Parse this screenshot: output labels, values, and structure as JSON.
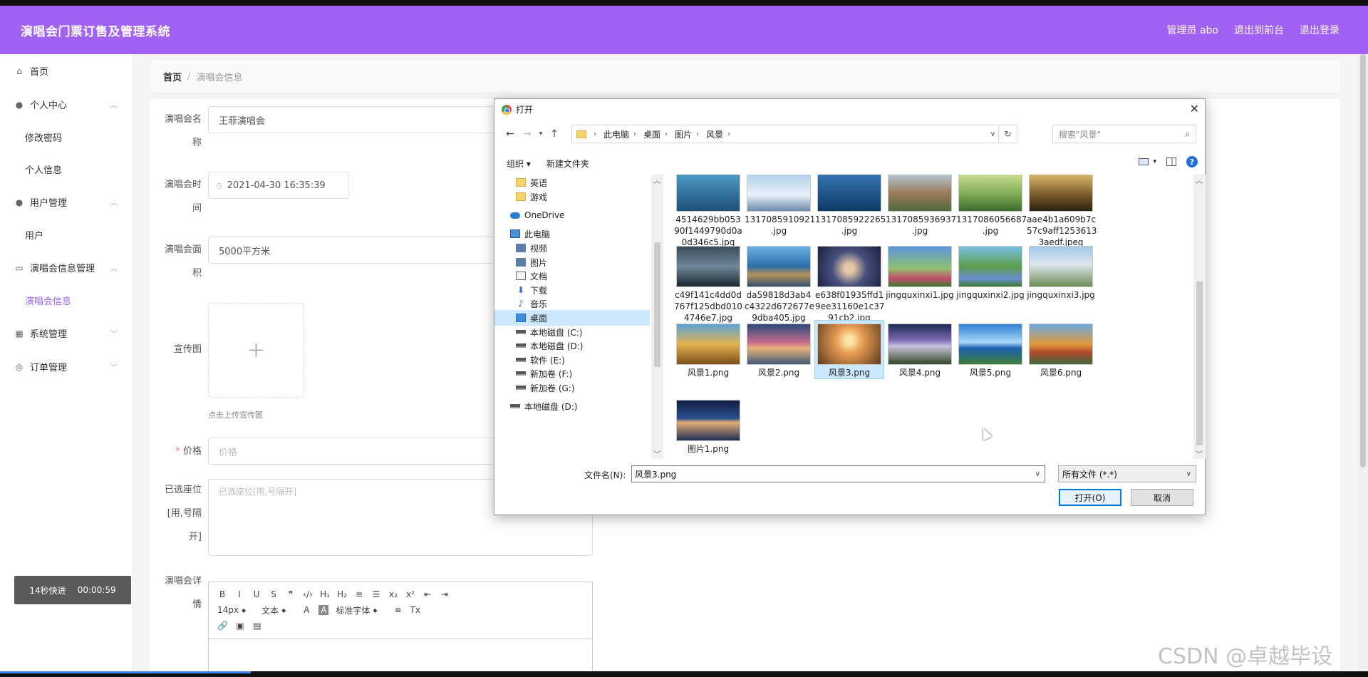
{
  "header": {
    "title": "演唱会门票订售及管理系统",
    "admin": "管理员 abo",
    "to_front": "退出到前台",
    "logout": "退出登录"
  },
  "sidebar": {
    "home": "首页",
    "personal": "个人中心",
    "change_password": "修改密码",
    "personal_info": "个人信息",
    "user_mgmt": "用户管理",
    "users": "用户",
    "concert_mgmt": "演唱会信息管理",
    "concert_info": "演唱会信息",
    "system_mgmt": "系统管理",
    "order_mgmt": "订单管理",
    "timer_label": "14秒快进",
    "timer_value": "00:00:59"
  },
  "breadcrumb": {
    "home": "首页",
    "sep": "/",
    "current": "演唱会信息"
  },
  "form": {
    "name_label_1": "演唱会名",
    "name_label_2": "称",
    "name_value": "王菲演唱会",
    "time_label_1": "演唱会时",
    "time_label_2": "间",
    "time_value": "2021-04-30 16:35:39",
    "area_label_1": "演唱会面",
    "area_label_2": "积",
    "area_value": "5000平方米",
    "poster_label": "宣传图",
    "upload_plus": "+",
    "upload_hint": "点击上传宣传图",
    "price_required": "*",
    "price_label": "价格",
    "price_placeholder": "价格",
    "seats_label_1": "已选座位",
    "seats_label_2": "[用,号隔",
    "seats_label_3": "开]",
    "seats_placeholder": "已选座位[用,号隔开]",
    "detail_label_1": "演唱会详",
    "detail_label_2": "情"
  },
  "editor": {
    "row1": [
      "B",
      "I",
      "U",
      "S",
      "❞",
      "‹/›",
      "H₁",
      "H₂",
      "≡",
      "☰",
      "x₂",
      "x²",
      "⇤",
      "⇥"
    ],
    "size": "14px",
    "text": "文本",
    "font": "标准字体",
    "row3": [
      "🔗",
      "▣",
      "▤"
    ]
  },
  "dialog": {
    "title": "打开",
    "path": [
      "此电脑",
      "桌面",
      "图片",
      "风景"
    ],
    "search_placeholder": "搜索\"风景\"",
    "organize": "组织 ▾",
    "new_folder": "新建文件夹",
    "tree": [
      "英语",
      "游戏",
      "OneDrive",
      "此电脑",
      "视频",
      "图片",
      "文档",
      "下载",
      "音乐",
      "桌面",
      "本地磁盘 (C:)",
      "本地磁盘 (D:)",
      "软件 (E:)",
      "新加卷 (F:)",
      "新加卷 (G:)",
      "本地磁盘 (D:)"
    ],
    "files": [
      {
        "name": "4514629bb053 90f1449790d0a 0d346c5.jpg"
      },
      {
        "name": "1317085910921 .jpg"
      },
      {
        "name": "1317085922265 .jpg"
      },
      {
        "name": "1317085936937 .jpg"
      },
      {
        "name": "1317086056687 .jpg"
      },
      {
        "name": "aae4b1a609b7c 57c9aff1253613 3aedf.jpeg"
      },
      {
        "name": "c49f141c4dd0d 767f125dbd010 4746e7.jpg"
      },
      {
        "name": "da59818d3ab4 c4322d672677e 9dba405.jpg"
      },
      {
        "name": "e638f01935ffd1 9ee31160e1c37 91cb2.jpg"
      },
      {
        "name": "jingquxinxi1.jpg"
      },
      {
        "name": "jingquxinxi2.jpg"
      },
      {
        "name": "jingquxinxi3.jpg"
      },
      {
        "name": "风景1.png"
      },
      {
        "name": "风景2.png"
      },
      {
        "name": "风景3.png"
      },
      {
        "name": "风景4.png"
      },
      {
        "name": "风景5.png"
      },
      {
        "name": "风景6.png"
      },
      {
        "name": "图片1.png"
      }
    ],
    "filename_label": "文件名(N):",
    "filename_value": "风景3.png",
    "filetype": "所有文件 (*.*)",
    "open_btn": "打开(O)",
    "cancel_btn": "取消"
  },
  "watermark": "CSDN @卓越毕设"
}
